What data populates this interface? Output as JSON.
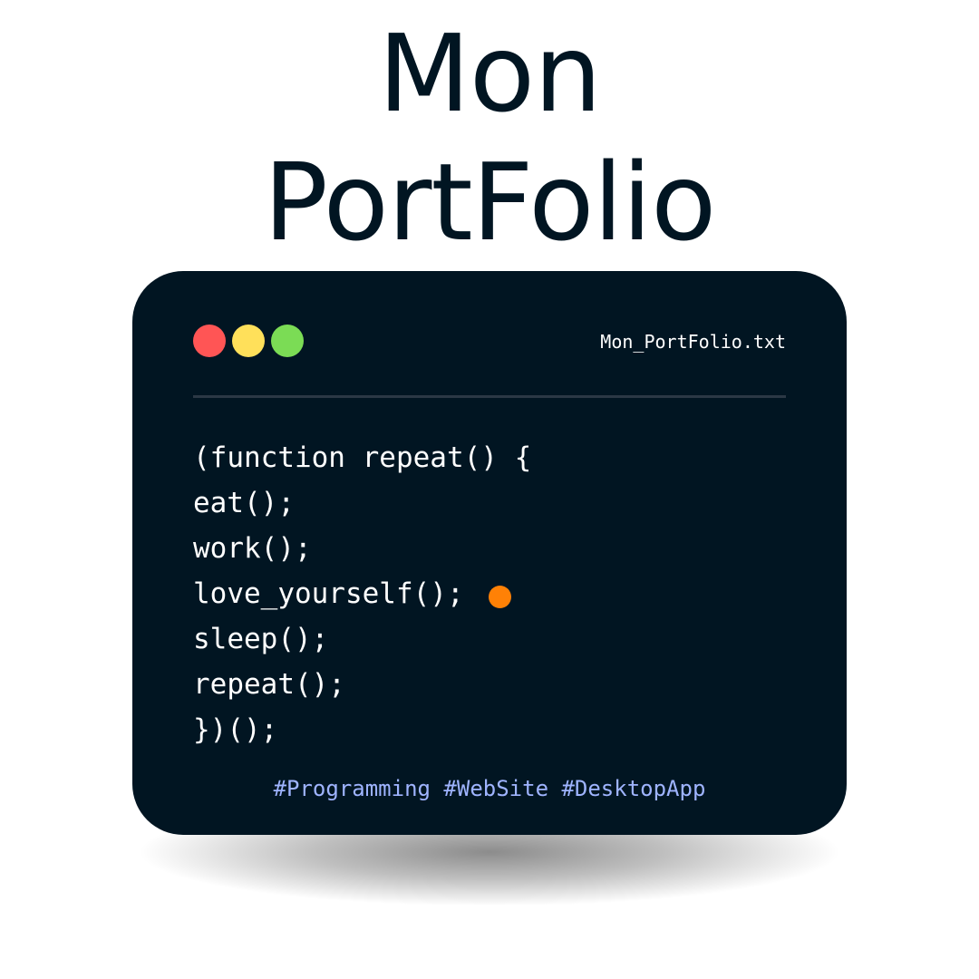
{
  "title": {
    "line1": "Mon",
    "line2": "PortFolio"
  },
  "window": {
    "filename": "Mon_PortFolio.txt",
    "controls": {
      "close_color": "#FF5555",
      "minimize_color": "#FFE05A",
      "maximize_color": "#7BDC55"
    }
  },
  "code": {
    "lines": [
      "(function repeat() {",
      "eat();",
      "work();",
      "love_yourself();",
      "sleep();",
      "repeat();",
      "})();"
    ],
    "cursor_color": "#FF8106"
  },
  "hashtags": "#Programming #WebSite #DesktopApp",
  "colors": {
    "background": "#FFFFFF",
    "title_text": "#011522",
    "card_background": "#011522",
    "code_text": "#FFFFFF",
    "hashtag_text": "#9FB4FF"
  }
}
